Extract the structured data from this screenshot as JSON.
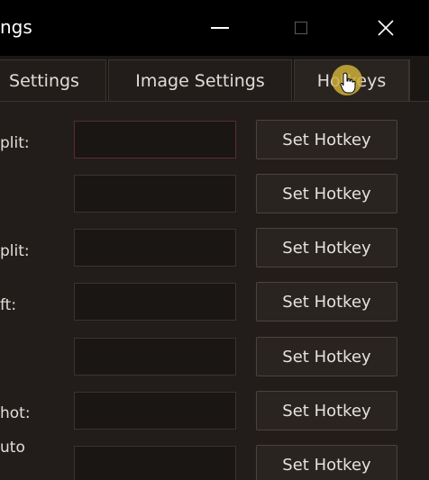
{
  "window": {
    "title": "ngs",
    "min_glyph": "—",
    "close_glyph": "✕"
  },
  "tabs": [
    {
      "label": "Settings"
    },
    {
      "label": "Image Settings"
    },
    {
      "label": "Hotkeys",
      "selected": true
    }
  ],
  "rows": [
    {
      "label": "plit:",
      "input_value": "",
      "button_label": "Set Hotkey"
    },
    {
      "label": "",
      "input_value": "",
      "button_label": "Set Hotkey"
    },
    {
      "label": "plit:",
      "input_value": "",
      "button_label": "Set Hotkey"
    },
    {
      "label": "ft:",
      "input_value": "",
      "button_label": "Set Hotkey"
    },
    {
      "label": "",
      "input_value": "",
      "button_label": "Set Hotkey"
    },
    {
      "label": "hot:",
      "input_value": "",
      "button_label": "Set Hotkey"
    },
    {
      "label": "uto",
      "input_value": "",
      "button_label": "Set Hotkey"
    }
  ],
  "colors": {
    "background": "#221d1a",
    "titlebar": "#000000",
    "cursor_highlight": "#cdaf3c"
  }
}
